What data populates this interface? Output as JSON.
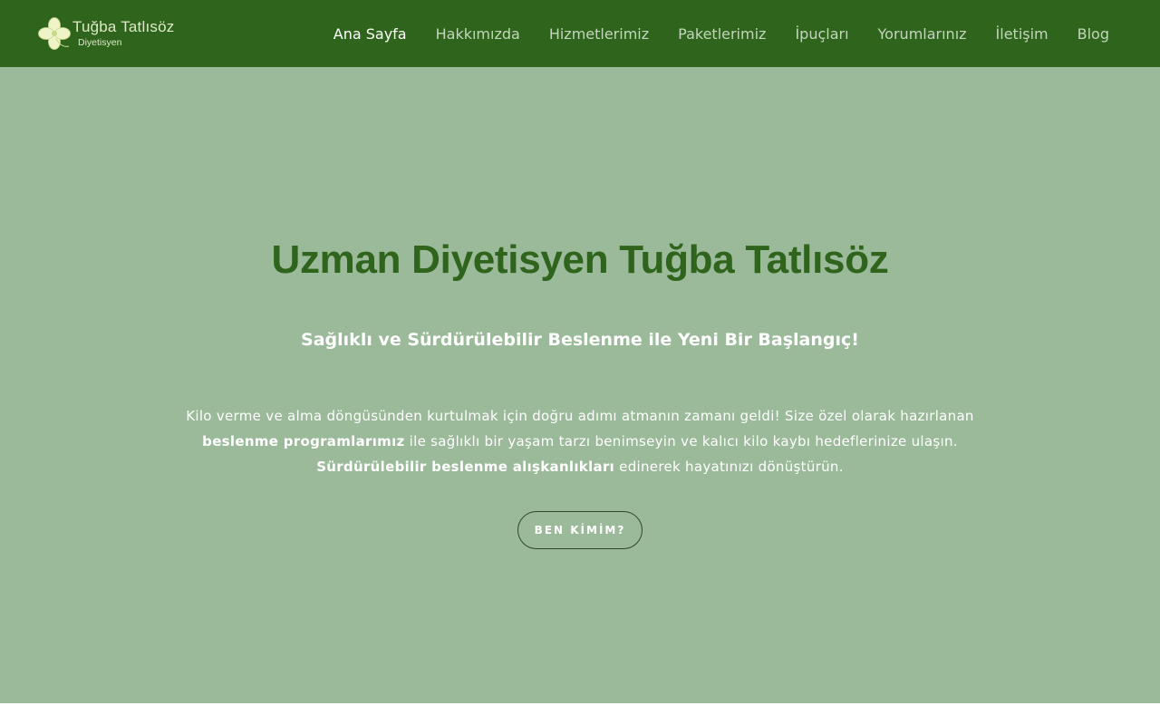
{
  "brand": {
    "name": "Tuğba Tatlısöz",
    "subtitle": "Diyetisyen",
    "logo_icon": "clover-icon",
    "logo_color": "#eef3c8"
  },
  "nav": {
    "items": [
      {
        "label": "Ana Sayfa",
        "active": true
      },
      {
        "label": "Hakkımızda",
        "active": false
      },
      {
        "label": "Hizmetlerimiz",
        "active": false
      },
      {
        "label": "Paketlerimiz",
        "active": false
      },
      {
        "label": "İpuçları",
        "active": false
      },
      {
        "label": "Yorumlarınız",
        "active": false
      },
      {
        "label": "İletişim",
        "active": false
      },
      {
        "label": "Blog",
        "active": false
      }
    ]
  },
  "hero": {
    "title": "Uzman Diyetisyen Tuğba Tatlısöz",
    "subtitle": "Sağlıklı ve Sürdürülebilir Beslenme ile Yeni Bir Başlangıç!",
    "paragraph": {
      "line1": "Kilo verme ve alma döngüsünden kurtulmak için doğru adımı atmanın zamanı geldi! Size özel olarak hazırlanan",
      "bold1": "beslenme programlarımız",
      "line2": " ile sağlıklı bir yaşam tarzı benimseyin ve kalıcı kilo kaybı hedeflerinize ulaşın.",
      "bold2": "Sürdürülebilir beslenme alışkanlıkları",
      "line3": " edinerek hayatınızı dönüştürün."
    },
    "button_label": "BEN KİMİM?"
  },
  "colors": {
    "navbar": "#2e641c",
    "hero_bg": "#9bba9a",
    "title": "#2e641c",
    "text": "#ffffff"
  }
}
